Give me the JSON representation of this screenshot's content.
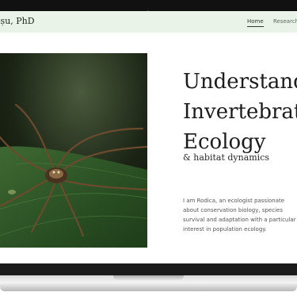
{
  "header": {
    "brand": "așu, PhD",
    "nav": [
      {
        "label": "Home",
        "active": true
      },
      {
        "label": "Research",
        "active": false
      }
    ]
  },
  "hero": {
    "title_lines": [
      "Understandin",
      "Invertebrate",
      "Ecology"
    ],
    "subtitle": "& habitat dynamics",
    "bio": "I am Rodica, an ecologist passionate about conservation biology, species survival and adaptation with a particular interest in population ecology."
  },
  "colors": {
    "nav_background": "#eaf3e8",
    "text_dark": "#1c1c1c",
    "bezel": "#111111"
  }
}
